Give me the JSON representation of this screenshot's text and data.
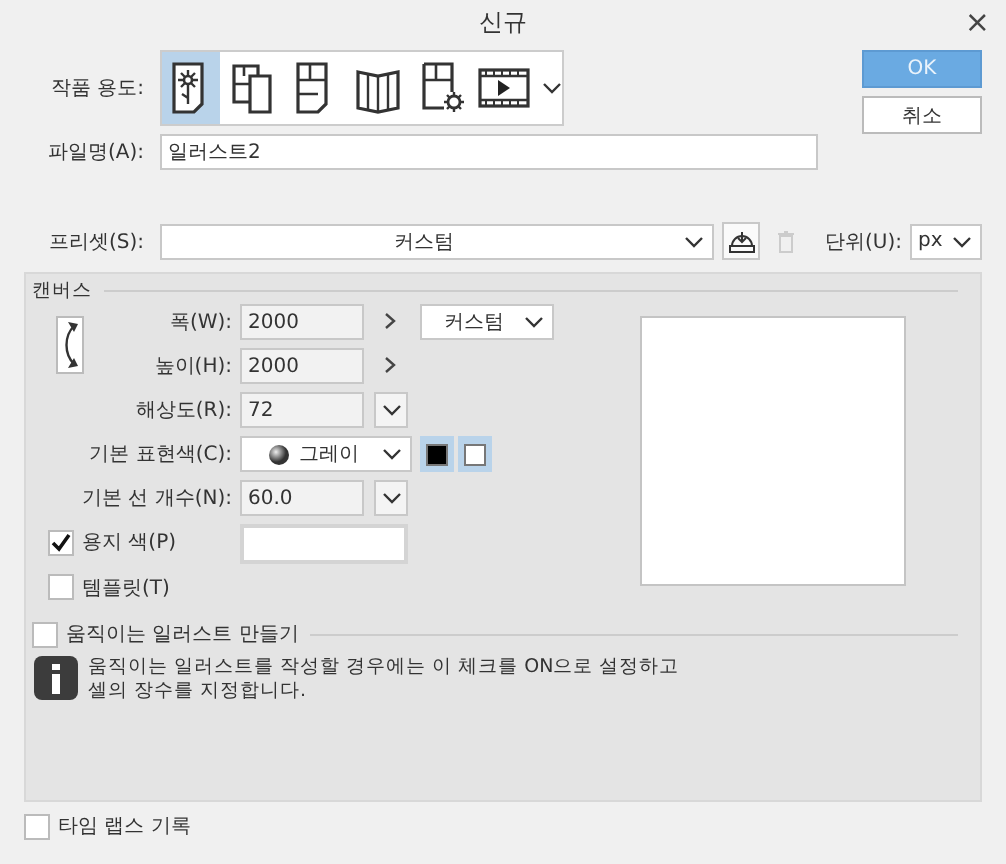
{
  "window": {
    "title": "신규",
    "close": "×"
  },
  "usage": {
    "label": "작품 용도:",
    "options": [
      {
        "kind": "illustration",
        "selected": true
      },
      {
        "kind": "comic_pages",
        "selected": false
      },
      {
        "kind": "single_page",
        "selected": false
      },
      {
        "kind": "book",
        "selected": false
      },
      {
        "kind": "page_settings",
        "selected": false
      },
      {
        "kind": "animation",
        "selected": false
      }
    ]
  },
  "buttons": [
    {
      "label": "OK",
      "primary": true
    },
    {
      "label": "취소",
      "primary": false
    }
  ],
  "file_name": {
    "label": "파일명(A):",
    "value": "일러스트2"
  },
  "preset": {
    "label": "프리셋(S):",
    "value": "커스텀"
  },
  "unit": {
    "label": "단위(U):",
    "value": "px"
  },
  "canvas": {
    "title": "캔버스",
    "fields": [
      {
        "kind": "size",
        "label": "폭(W):",
        "value": "2000",
        "preset": "커스텀"
      },
      {
        "kind": "size",
        "label": "높이(H):",
        "value": "2000"
      },
      {
        "kind": "combo",
        "label": "해상도(R):",
        "value": "72"
      },
      {
        "kind": "color_mode",
        "label": "기본 표현색(C):",
        "value": "그레이",
        "swatches": [
          {
            "color": "#000000"
          },
          {
            "color": "#ffffff"
          }
        ]
      },
      {
        "kind": "combo",
        "label": "기본 선 개수(N):",
        "value": "60.0"
      },
      {
        "kind": "paper",
        "label": "용지 색(P)",
        "checked": true
      },
      {
        "kind": "check",
        "label": "템플릿(T)",
        "checked": false
      }
    ]
  },
  "animation": {
    "label": "움직이는 일러스트 만들기",
    "checked": false,
    "info_lines": [
      "움직이는 일러스트를 작성할 경우에는 이 체크를 ON으로 설정하고",
      "셀의 장수를 지정합니다."
    ]
  },
  "timelapse": {
    "label": "타임 랩스 기록",
    "checked": false
  }
}
